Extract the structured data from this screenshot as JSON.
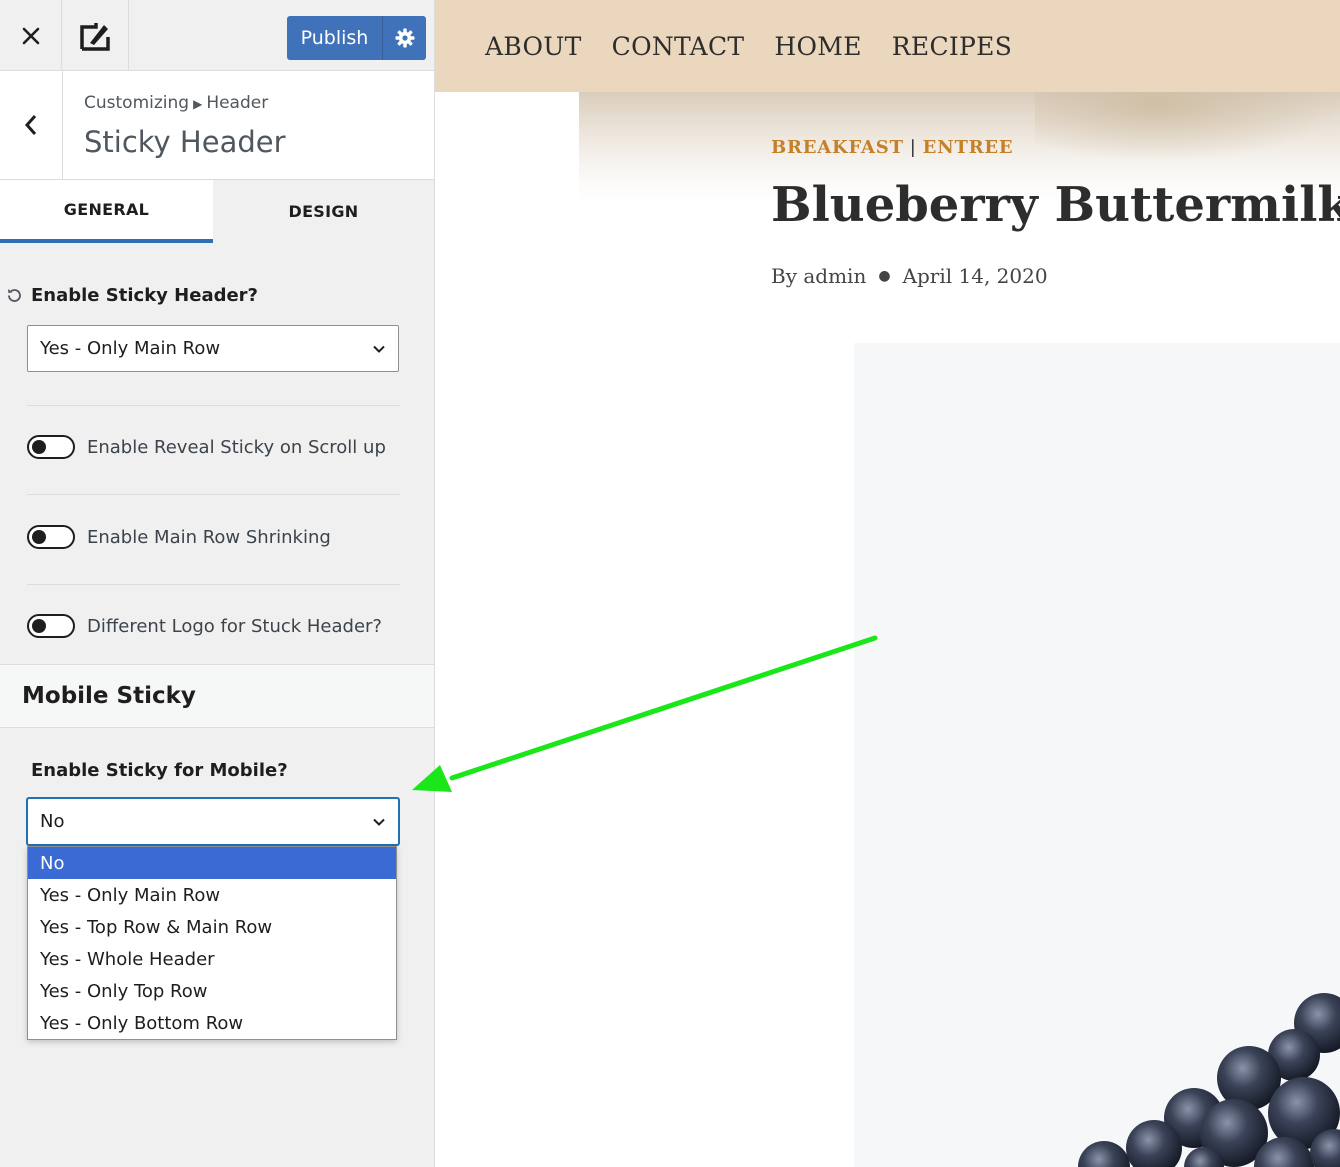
{
  "toolbar": {
    "publish_label": "Publish"
  },
  "section": {
    "breadcrumb_parent": "Customizing",
    "breadcrumb_child": "Header",
    "title": "Sticky Header"
  },
  "tabs": [
    {
      "label": "GENERAL"
    },
    {
      "label": "DESIGN"
    }
  ],
  "general": {
    "enable_sticky_label": "Enable Sticky Header?",
    "enable_sticky_value": "Yes - Only Main Row",
    "toggles": [
      {
        "label": "Enable Reveal Sticky on Scroll up",
        "on": false
      },
      {
        "label": "Enable Main Row Shrinking",
        "on": false
      },
      {
        "label": "Different Logo for Stuck Header?",
        "on": false
      }
    ]
  },
  "mobile": {
    "group_title": "Mobile Sticky",
    "label": "Enable Sticky for Mobile?",
    "value": "No",
    "options": [
      "No",
      "Yes - Only Main Row",
      "Yes - Top Row & Main Row",
      "Yes - Whole Header",
      "Yes - Only Top Row",
      "Yes - Only Bottom Row"
    ],
    "selected_option": "No"
  },
  "site": {
    "nav": [
      "ABOUT",
      "CONTACT",
      "HOME",
      "RECIPES"
    ],
    "categories": [
      "BREAKFAST",
      "ENTREE"
    ],
    "post_title": "Blueberry Buttermilk Pa",
    "author": "By admin",
    "date": "April 14, 2020"
  },
  "colors": {
    "publish": "#3f72b8",
    "tab_active_border": "#2f6fb4",
    "option_selected": "#3a6bd4",
    "nav_bg": "#ead7bd",
    "category": "#c5812a",
    "arrow": "#1ae61a"
  },
  "icons": {
    "close": "close-icon",
    "theme": "theme-customizer-icon",
    "settings": "gear-icon",
    "back": "chevron-left-icon",
    "reset": "reset-icon",
    "select_chevron": "chevron-down-icon"
  }
}
